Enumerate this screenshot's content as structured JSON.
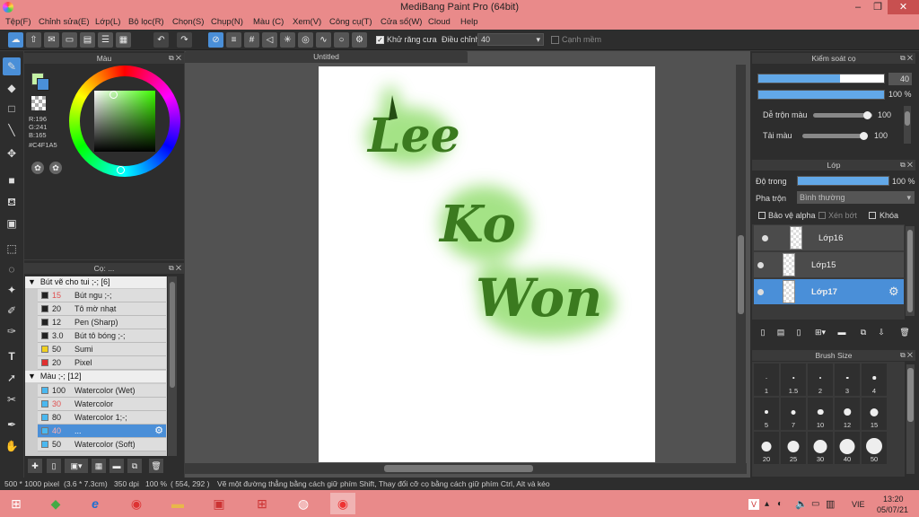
{
  "window": {
    "title": "MediBang Paint Pro (64bit)",
    "minimize": "–",
    "maximize": "❐",
    "close": "✕"
  },
  "menu": [
    "Tệp(F)",
    "Chỉnh sửa(E)",
    "Lớp(L)",
    "Bộ lọc(R)",
    "Chọn(S)",
    "Chụp(N)",
    "Màu (C)",
    "Xem(V)",
    "Công cụ(T)",
    "Cửa sổ(W)",
    "Cloud",
    "Help"
  ],
  "toolbar": {
    "antialias_label": "Khử răng cưa",
    "adjust_label": "Điều chỉnh",
    "adjust_value": "40",
    "edge_label": "Cạnh mềm"
  },
  "color_panel": {
    "title": "Màu",
    "r": "R:196",
    "g": "G:241",
    "b": "B:165",
    "hex": "#C4F1A5",
    "color": "#c4f1a5"
  },
  "brush_panel": {
    "title": "Cọ: ...",
    "groups": [
      {
        "name": "Bút vẽ cho tui ;-; [6]",
        "items": [
          {
            "size": "15",
            "name": "Bút ngu ;-;",
            "color": "#222222",
            "size_color": "#e05050"
          },
          {
            "size": "20",
            "name": "Tô mờ nhạt",
            "color": "#222222",
            "size_color": "#222222"
          },
          {
            "size": "12",
            "name": "Pen (Sharp)",
            "color": "#222222",
            "size_color": "#222222"
          },
          {
            "size": "3.0",
            "name": "Bút tô bóng ;-;",
            "color": "#222222",
            "size_color": "#222222"
          },
          {
            "size": "50",
            "name": "Sumi",
            "color": "#f0d020",
            "size_color": "#222222"
          },
          {
            "size": "20",
            "name": "Pixel",
            "color": "#e03030",
            "size_color": "#222222"
          }
        ]
      },
      {
        "name": "Màu ;-; [12]",
        "items": [
          {
            "size": "100",
            "name": "Watercolor (Wet)",
            "color": "#4ab8f0",
            "size_color": "#222222"
          },
          {
            "size": "30",
            "name": "Watercolor",
            "color": "#4ab8f0",
            "size_color": "#e05050"
          },
          {
            "size": "80",
            "name": "Watercolor 1;-;",
            "color": "#4ab8f0",
            "size_color": "#222222"
          },
          {
            "size": "40",
            "name": "...",
            "color": "#4ab8f0",
            "size_color": "#e05050",
            "selected": true
          },
          {
            "size": "50",
            "name": "Watercolor (Soft)",
            "color": "#4ab8f0",
            "size_color": "#222222"
          }
        ]
      }
    ]
  },
  "canvas": {
    "tab": "Untitled",
    "text_lines": [
      "Lee",
      "Ko",
      "Won"
    ]
  },
  "brush_control": {
    "title": "Kiểm soát cọ",
    "size_value": "40",
    "size_fraction": 0.65,
    "opacity_value": "100 %",
    "blend_label": "Dễ trộn màu",
    "blend_value": "100",
    "water_label": "Tải màu",
    "water_value": "100"
  },
  "layer_panel": {
    "title": "Lớp",
    "opacity_label": "Độ trong",
    "opacity_value": "100 %",
    "blend_label": "Pha trộn",
    "blend_mode": "Bình thường",
    "protect_alpha": "Bảo vệ alpha",
    "clipping": "Xén bớt",
    "lock": "Khóa",
    "layers": [
      {
        "name": "Lớp16",
        "selected": false
      },
      {
        "name": "Lớp15",
        "selected": false
      },
      {
        "name": "Lớp17",
        "selected": true
      }
    ]
  },
  "brush_size_panel": {
    "title": "Brush Size",
    "sizes": [
      "1",
      "1.5",
      "2",
      "3",
      "4",
      "5",
      "7",
      "10",
      "12",
      "15",
      "20",
      "25",
      "30",
      "40",
      "50"
    ]
  },
  "status": {
    "dims": "500 * 1000 pixel",
    "cm": "(3.6 * 7.3cm)",
    "dpi": "350 dpi",
    "zoom": "100 %",
    "coords": "( 554, 292 )",
    "hint": "Vẽ một đường thẳng bằng cách giữ phím Shift, Thay đổi cỡ cọ bằng cách giữ phím Ctrl, Alt và kéo"
  },
  "taskbar": {
    "lang": "VIE",
    "time": "13:20",
    "date": "05/07/21"
  }
}
